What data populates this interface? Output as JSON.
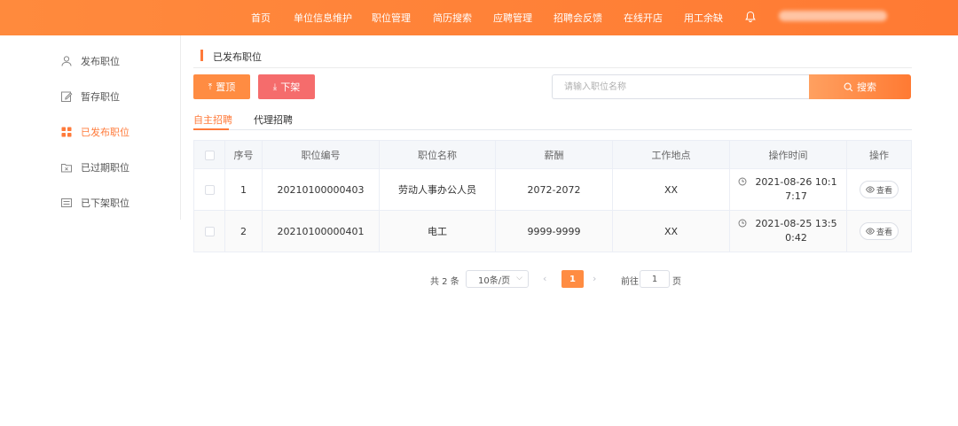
{
  "colors": {
    "brand": "#ff7a3a",
    "danger": "#f56c6c",
    "header_bg": "#ff8a3d"
  },
  "header": {
    "nav": [
      "首页",
      "单位信息维护",
      "职位管理",
      "简历搜索",
      "应聘管理",
      "招聘会反馈",
      "在线开店",
      "用工余缺"
    ],
    "bell_icon": "bell-icon"
  },
  "sidebar": {
    "items": [
      {
        "label": "发布职位",
        "icon": "user-icon"
      },
      {
        "label": "暂存职位",
        "icon": "edit-icon"
      },
      {
        "label": "已发布职位",
        "icon": "grid-icon"
      },
      {
        "label": "已过期职位",
        "icon": "folder-x-icon"
      },
      {
        "label": "已下架职位",
        "icon": "list-box-icon"
      }
    ],
    "active": "已发布职位"
  },
  "page": {
    "title": "已发布职位"
  },
  "toolbar": {
    "top_label": "置顶",
    "down_label": "下架"
  },
  "search": {
    "placeholder": "请输入职位名称",
    "value": "",
    "button_label": "搜索"
  },
  "tabs": [
    {
      "label": "自主招聘"
    },
    {
      "label": "代理招聘"
    }
  ],
  "active_tab": "自主招聘",
  "table": {
    "headers": [
      "序号",
      "职位编号",
      "职位名称",
      "薪酬",
      "工作地点",
      "操作时间",
      "操作"
    ],
    "rows": [
      {
        "no": "1",
        "code": "20210100000403",
        "name": "劳动人事办公人员",
        "salary": "2072-2072",
        "location": "XX",
        "time": "2021-08-26 10:17:17",
        "action": "查看"
      },
      {
        "no": "2",
        "code": "20210100000401",
        "name": "电工",
        "salary": "9999-9999",
        "location": "XX",
        "time": "2021-08-25 13:50:42",
        "action": "查看"
      }
    ]
  },
  "pagination": {
    "total_text": "共 2 条",
    "page_size": "10条/页",
    "current": "1",
    "goto_label": "前往",
    "goto_value": "1",
    "page_suffix": "页"
  }
}
